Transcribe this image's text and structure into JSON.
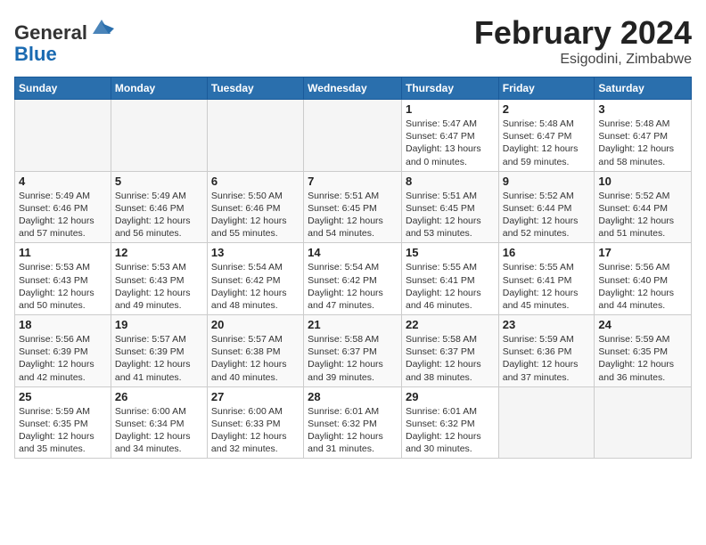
{
  "header": {
    "logo_general": "General",
    "logo_blue": "Blue",
    "month_title": "February 2024",
    "location": "Esigodini, Zimbabwe"
  },
  "calendar": {
    "days_of_week": [
      "Sunday",
      "Monday",
      "Tuesday",
      "Wednesday",
      "Thursday",
      "Friday",
      "Saturday"
    ],
    "weeks": [
      [
        {
          "day": "",
          "info": ""
        },
        {
          "day": "",
          "info": ""
        },
        {
          "day": "",
          "info": ""
        },
        {
          "day": "",
          "info": ""
        },
        {
          "day": "1",
          "info": "Sunrise: 5:47 AM\nSunset: 6:47 PM\nDaylight: 13 hours\nand 0 minutes."
        },
        {
          "day": "2",
          "info": "Sunrise: 5:48 AM\nSunset: 6:47 PM\nDaylight: 12 hours\nand 59 minutes."
        },
        {
          "day": "3",
          "info": "Sunrise: 5:48 AM\nSunset: 6:47 PM\nDaylight: 12 hours\nand 58 minutes."
        }
      ],
      [
        {
          "day": "4",
          "info": "Sunrise: 5:49 AM\nSunset: 6:46 PM\nDaylight: 12 hours\nand 57 minutes."
        },
        {
          "day": "5",
          "info": "Sunrise: 5:49 AM\nSunset: 6:46 PM\nDaylight: 12 hours\nand 56 minutes."
        },
        {
          "day": "6",
          "info": "Sunrise: 5:50 AM\nSunset: 6:46 PM\nDaylight: 12 hours\nand 55 minutes."
        },
        {
          "day": "7",
          "info": "Sunrise: 5:51 AM\nSunset: 6:45 PM\nDaylight: 12 hours\nand 54 minutes."
        },
        {
          "day": "8",
          "info": "Sunrise: 5:51 AM\nSunset: 6:45 PM\nDaylight: 12 hours\nand 53 minutes."
        },
        {
          "day": "9",
          "info": "Sunrise: 5:52 AM\nSunset: 6:44 PM\nDaylight: 12 hours\nand 52 minutes."
        },
        {
          "day": "10",
          "info": "Sunrise: 5:52 AM\nSunset: 6:44 PM\nDaylight: 12 hours\nand 51 minutes."
        }
      ],
      [
        {
          "day": "11",
          "info": "Sunrise: 5:53 AM\nSunset: 6:43 PM\nDaylight: 12 hours\nand 50 minutes."
        },
        {
          "day": "12",
          "info": "Sunrise: 5:53 AM\nSunset: 6:43 PM\nDaylight: 12 hours\nand 49 minutes."
        },
        {
          "day": "13",
          "info": "Sunrise: 5:54 AM\nSunset: 6:42 PM\nDaylight: 12 hours\nand 48 minutes."
        },
        {
          "day": "14",
          "info": "Sunrise: 5:54 AM\nSunset: 6:42 PM\nDaylight: 12 hours\nand 47 minutes."
        },
        {
          "day": "15",
          "info": "Sunrise: 5:55 AM\nSunset: 6:41 PM\nDaylight: 12 hours\nand 46 minutes."
        },
        {
          "day": "16",
          "info": "Sunrise: 5:55 AM\nSunset: 6:41 PM\nDaylight: 12 hours\nand 45 minutes."
        },
        {
          "day": "17",
          "info": "Sunrise: 5:56 AM\nSunset: 6:40 PM\nDaylight: 12 hours\nand 44 minutes."
        }
      ],
      [
        {
          "day": "18",
          "info": "Sunrise: 5:56 AM\nSunset: 6:39 PM\nDaylight: 12 hours\nand 42 minutes."
        },
        {
          "day": "19",
          "info": "Sunrise: 5:57 AM\nSunset: 6:39 PM\nDaylight: 12 hours\nand 41 minutes."
        },
        {
          "day": "20",
          "info": "Sunrise: 5:57 AM\nSunset: 6:38 PM\nDaylight: 12 hours\nand 40 minutes."
        },
        {
          "day": "21",
          "info": "Sunrise: 5:58 AM\nSunset: 6:37 PM\nDaylight: 12 hours\nand 39 minutes."
        },
        {
          "day": "22",
          "info": "Sunrise: 5:58 AM\nSunset: 6:37 PM\nDaylight: 12 hours\nand 38 minutes."
        },
        {
          "day": "23",
          "info": "Sunrise: 5:59 AM\nSunset: 6:36 PM\nDaylight: 12 hours\nand 37 minutes."
        },
        {
          "day": "24",
          "info": "Sunrise: 5:59 AM\nSunset: 6:35 PM\nDaylight: 12 hours\nand 36 minutes."
        }
      ],
      [
        {
          "day": "25",
          "info": "Sunrise: 5:59 AM\nSunset: 6:35 PM\nDaylight: 12 hours\nand 35 minutes."
        },
        {
          "day": "26",
          "info": "Sunrise: 6:00 AM\nSunset: 6:34 PM\nDaylight: 12 hours\nand 34 minutes."
        },
        {
          "day": "27",
          "info": "Sunrise: 6:00 AM\nSunset: 6:33 PM\nDaylight: 12 hours\nand 32 minutes."
        },
        {
          "day": "28",
          "info": "Sunrise: 6:01 AM\nSunset: 6:32 PM\nDaylight: 12 hours\nand 31 minutes."
        },
        {
          "day": "29",
          "info": "Sunrise: 6:01 AM\nSunset: 6:32 PM\nDaylight: 12 hours\nand 30 minutes."
        },
        {
          "day": "",
          "info": ""
        },
        {
          "day": "",
          "info": ""
        }
      ]
    ]
  }
}
